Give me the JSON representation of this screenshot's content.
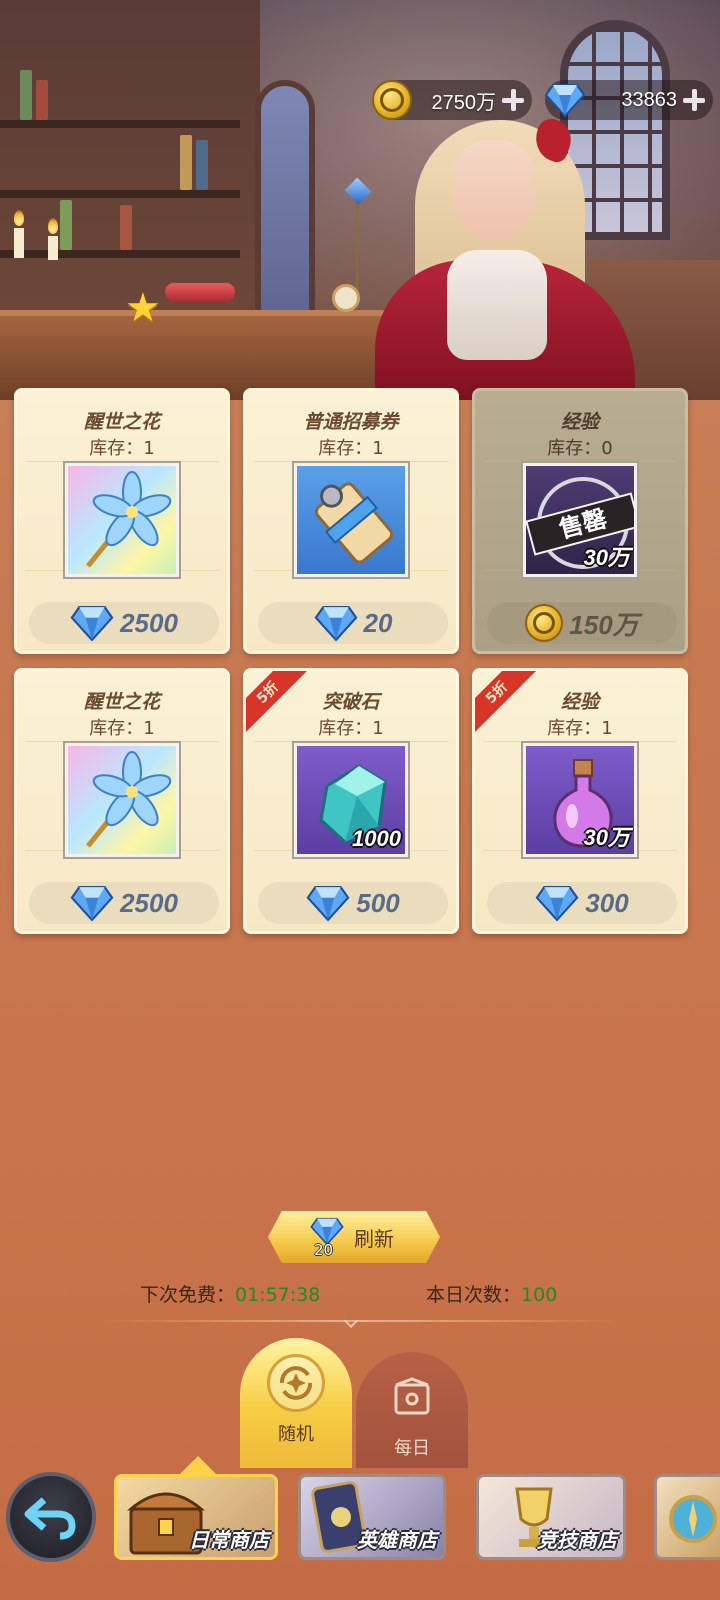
{
  "currency": {
    "gold": {
      "value": "2750万",
      "icon": "gold-coin-icon"
    },
    "gems": {
      "value": "33863",
      "icon": "diamond-icon"
    }
  },
  "shop_items": [
    {
      "name": "醒世之花",
      "stock": "库存：1",
      "price": "2500",
      "price_icon": "diamond-icon",
      "item_icon": "blue-flower-icon",
      "discount": "",
      "qty": "",
      "sold_out": false
    },
    {
      "name": "普通招募券",
      "stock": "库存：1",
      "price": "20",
      "price_icon": "diamond-icon",
      "item_icon": "scroll-icon",
      "discount": "",
      "qty": "",
      "sold_out": false
    },
    {
      "name": "经验",
      "stock": "库存：0",
      "price": "150万",
      "price_icon": "gold-coin-icon",
      "item_icon": "exp-potion-icon",
      "discount": "",
      "qty": "30万",
      "sold_out": true,
      "sold_label": "售罄"
    },
    {
      "name": "醒世之花",
      "stock": "库存：1",
      "price": "2500",
      "price_icon": "diamond-icon",
      "item_icon": "blue-flower-icon",
      "discount": "",
      "qty": "",
      "sold_out": false
    },
    {
      "name": "突破石",
      "stock": "库存：1",
      "price": "500",
      "price_icon": "diamond-icon",
      "item_icon": "crystal-stone-icon",
      "discount": "5折",
      "qty": "1000",
      "sold_out": false
    },
    {
      "name": "经验",
      "stock": "库存：1",
      "price": "300",
      "price_icon": "diamond-icon",
      "item_icon": "exp-potion-icon",
      "discount": "5折",
      "qty": "30万",
      "sold_out": false
    }
  ],
  "refresh": {
    "label": "刷新",
    "cost": "20"
  },
  "timer": {
    "next_free_label": "下次免费：",
    "next_free_value": "01:57:38",
    "today_label": "本日次数：",
    "today_value": "100"
  },
  "tabs": [
    {
      "label": "随机",
      "active": true
    },
    {
      "label": "每日",
      "active": false
    }
  ],
  "stores": [
    {
      "label": "日常商店",
      "active": true
    },
    {
      "label": "英雄商店",
      "active": false
    },
    {
      "label": "竞技商店",
      "active": false
    },
    {
      "label": "",
      "active": false
    }
  ],
  "colors": {
    "accent_gold": "#f4c94a",
    "timer_green": "#1f8a2a",
    "discount_red": "#d8352a"
  }
}
